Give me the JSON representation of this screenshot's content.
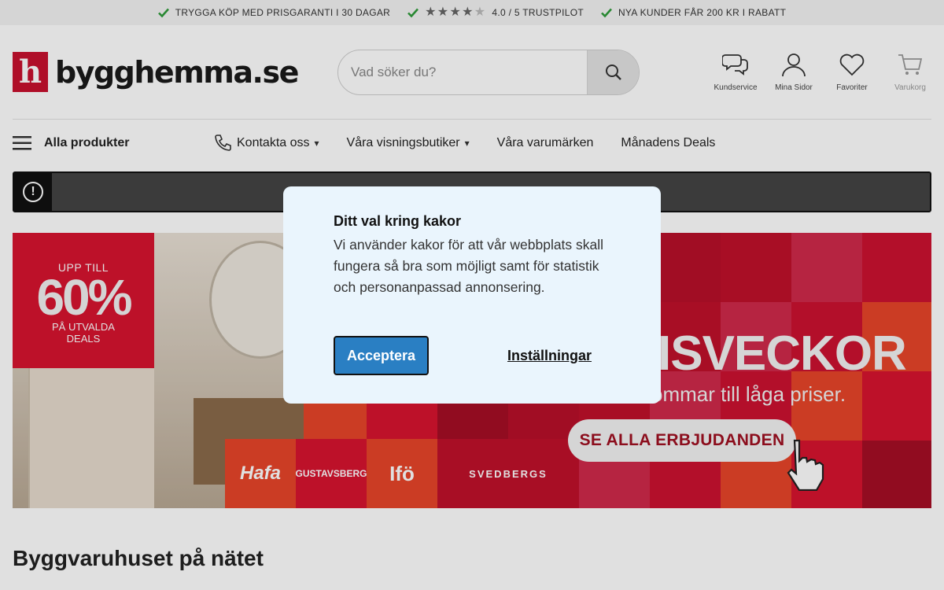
{
  "usp": {
    "item1": "TRYGGA KÖP MED PRISGARANTI I 30 DAGAR",
    "rating": "4.0 / 5 TRUSTPILOT",
    "rating_value": 4,
    "item3": "NYA KUNDER FÅR 200 KR I RABATT"
  },
  "header": {
    "logo_letter": "h",
    "logo_text": "bygghemma.se",
    "search_placeholder": "Vad söker du?",
    "icons": {
      "customer_service": "Kundservice",
      "my_pages": "Mina Sidor",
      "favorites": "Favoriter",
      "cart": "Varukorg"
    }
  },
  "nav": {
    "all_products": "Alla produkter",
    "contact": "Kontakta oss",
    "showrooms": "Våra visningsbutiker",
    "brands": "Våra varumärken",
    "deals": "Månadens Deals"
  },
  "alert": {
    "icon_text": "!"
  },
  "hero": {
    "promo_upp": "UPP TILL",
    "promo_pct": "60%",
    "promo_sub1": "PÅ UTVALDA",
    "promo_sub2": "DEALS",
    "headline": "ISVECKOR",
    "subline": "ömmar till låga priser.",
    "cta": "SE ALLA ERBJUDANDEN",
    "brands": [
      "Hafa",
      "GUSTAVSBERG",
      "Ifö",
      "SVEDBERGS"
    ]
  },
  "section": {
    "title": "Byggvaruhuset på nätet"
  },
  "cookie": {
    "title": "Ditt val kring kakor",
    "text": "Vi använder kakor för att vår webbplats skall fungera så bra som möjligt samt för statistik och personanpassad annonsering.",
    "accept": "Acceptera",
    "settings": "Inställningar"
  },
  "colors": {
    "brand_red": "#c8102e",
    "accept_blue": "#2a7fc3",
    "check_green": "#2e9b3a",
    "modal_bg": "#eaf5fd"
  }
}
